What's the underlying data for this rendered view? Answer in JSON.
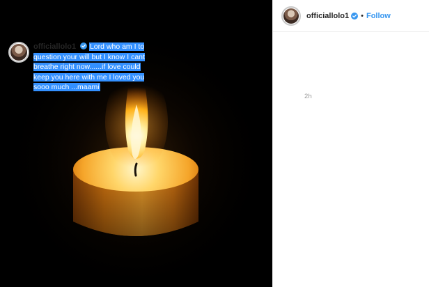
{
  "post": {
    "image_alt": "Lit candle on black background"
  },
  "header": {
    "username": "officiallolo1",
    "separator": "•",
    "follow_label": "Follow"
  },
  "caption": {
    "username": "officiallolo1",
    "text": "Lord who am I to question your will but I know I cant breathe right now......if love could keep you here with me I loved you sooo much ...maami",
    "time": "2h"
  },
  "colors": {
    "follow": "#3897f0",
    "selection": "#3390ff",
    "verified": "#3897f0"
  },
  "icons": {
    "verified": "verified-badge-icon"
  }
}
